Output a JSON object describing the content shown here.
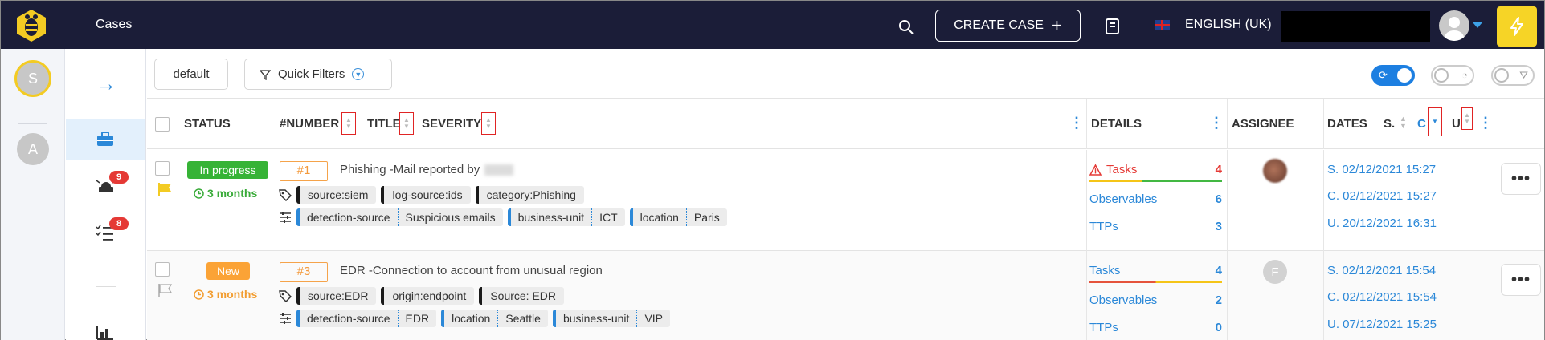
{
  "header": {
    "title": "Cases",
    "create_label": "CREATE CASE",
    "language": "ENGLISH (UK)"
  },
  "orgs": [
    "S",
    "A"
  ],
  "nav": {
    "alerts_badge": "9",
    "tasks_badge": "8"
  },
  "toolbar": {
    "default_label": "default",
    "quick_filters_label": "Quick Filters"
  },
  "table": {
    "headers": {
      "status": "STATUS",
      "number": "#NUMBER",
      "title": "TITLE",
      "severity": "SEVERITY",
      "details": "DETAILS",
      "assignee": "ASSIGNEE",
      "dates": "DATES",
      "dates_s": "S.",
      "dates_c": "C",
      "dates_u": "U"
    },
    "rows": [
      {
        "status": "In progress",
        "age": "3 months",
        "number": "#1",
        "title": "Phishing -Mail reported by",
        "tags": [
          "source:siem",
          "log-source:ids",
          "category:Phishing"
        ],
        "custom_fields": [
          {
            "key": "detection-source",
            "value": "Suspicious emails"
          },
          {
            "key": "business-unit",
            "value": "ICT"
          },
          {
            "key": "location",
            "value": "Paris"
          }
        ],
        "tasks_label": "Tasks",
        "tasks_count": "4",
        "observables_label": "Observables",
        "observables_count": "6",
        "ttps_label": "TTPs",
        "ttps_count": "3",
        "date_s": "S. 02/12/2021 15:27",
        "date_c": "C. 02/12/2021 15:27",
        "date_u": "U. 20/12/2021 16:31",
        "more": "•••"
      },
      {
        "status": "New",
        "age": "3 months",
        "number": "#3",
        "title": "EDR -Connection to account from unusual region",
        "tags": [
          "source:EDR",
          "origin:endpoint",
          "Source: EDR"
        ],
        "custom_fields": [
          {
            "key": "detection-source",
            "value": "EDR"
          },
          {
            "key": "location",
            "value": "Seattle"
          },
          {
            "key": "business-unit",
            "value": "VIP"
          }
        ],
        "tasks_label": "Tasks",
        "tasks_count": "4",
        "observables_label": "Observables",
        "observables_count": "2",
        "ttps_label": "TTPs",
        "ttps_count": "0",
        "assignee_initial": "F",
        "date_s": "S. 02/12/2021 15:54",
        "date_c": "C. 02/12/2021 15:54",
        "date_u": "U. 07/12/2021 15:25",
        "more": "•••"
      }
    ]
  },
  "colors": {
    "topbar": "#1b1d38",
    "accent": "#2b88d8",
    "in_progress": "#36b336",
    "new": "#fba336",
    "alert_red": "#e53935",
    "bolt": "#f6d426"
  }
}
